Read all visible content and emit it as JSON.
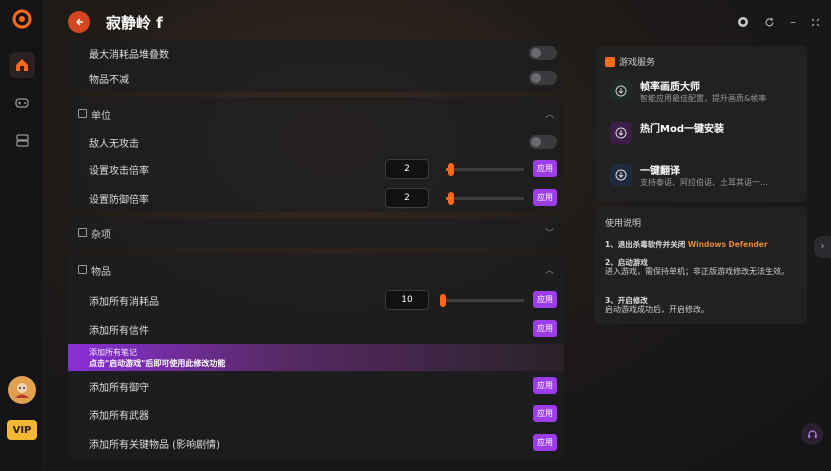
{
  "app": {
    "title": "寂静岭 f"
  },
  "sections": {
    "top": {
      "rows": [
        {
          "label": "最大消耗品堆叠数"
        },
        {
          "label": "物品不减"
        }
      ]
    },
    "unit": {
      "title": "单位",
      "rows": [
        {
          "label": "敌人无攻击"
        },
        {
          "label": "设置攻击倍率",
          "value": "2",
          "fill": 0.03,
          "apply": "应用"
        },
        {
          "label": "设置防御倍率",
          "value": "2",
          "fill": 0.03,
          "apply": "应用"
        }
      ]
    },
    "misc": {
      "title": "杂项"
    },
    "items": {
      "title": "物品",
      "rows": [
        {
          "label": "添加所有消耗品",
          "value": "10",
          "fill": 0.0,
          "apply": "应用"
        },
        {
          "label": "添加所有信件",
          "apply": "应用"
        },
        {
          "label": "添加所有御守",
          "apply": "应用"
        },
        {
          "label": "添加所有武器",
          "apply": "应用"
        },
        {
          "label": "添加所有关键物品 (影响剧情)",
          "apply": "应用"
        }
      ]
    }
  },
  "notice": {
    "line1": "添加所有笔记",
    "line2": "点击\"启动游戏\"后即可使用此修改功能"
  },
  "services": {
    "title": "游戏服务",
    "items": [
      {
        "title": "帧率画质大师",
        "desc": "智能应用最佳配置，提升画质&帧率"
      },
      {
        "title": "热门Mod一键安装",
        "desc": ""
      },
      {
        "title": "一键翻译",
        "desc": "支持泰语、阿拉伯语、土耳其语一..."
      }
    ]
  },
  "usage": {
    "title": "使用说明",
    "step1": "1、退出杀毒软件并关闭",
    "step1_highlight": "Windows Defender",
    "step2_title": "2、启动游戏",
    "step2_body": "进入游戏，需保持单机；非正版游戏修改无法生效。",
    "step3_title": "3、开启修改",
    "step3_body": "启动游戏成功后，开启修改。"
  },
  "sidebar": {
    "vip_label": "VIP"
  },
  "colors": {
    "accent": "#ff6a1a",
    "apply": "#9b3de8",
    "back": "#d4461f"
  }
}
